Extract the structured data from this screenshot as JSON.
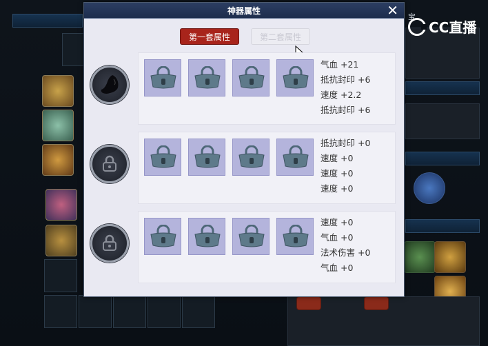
{
  "dialog": {
    "title": "神器属性",
    "close_label": "✕"
  },
  "tabs": [
    {
      "label": "第一套属性",
      "active": true
    },
    {
      "label": "第二套属性",
      "active": false
    }
  ],
  "rows": [
    {
      "orb_icon": "artifact-silhouette-icon",
      "slot_icon": "lock-icon",
      "stats": [
        "气血 +21",
        "抵抗封印 +6",
        "速度 +2.2",
        "抵抗封印 +6"
      ]
    },
    {
      "orb_icon": "lock-icon",
      "slot_icon": "lock-icon",
      "stats": [
        "抵抗封印 +0",
        "速度 +0",
        "速度 +0",
        "速度 +0"
      ]
    },
    {
      "orb_icon": "lock-icon",
      "slot_icon": "lock-icon",
      "stats": [
        "速度 +0",
        "气血 +0",
        "法术伤害 +0",
        "气血 +0"
      ]
    }
  ],
  "watermark": {
    "text": "CC直播"
  },
  "background": {
    "top_right_fragment": "宝"
  },
  "colors": {
    "tab_active": "#a8241b",
    "slot_fill": "#b4b4dc",
    "panel_bg": "#f1f1f7",
    "titlebar": "#1d2d4d"
  }
}
